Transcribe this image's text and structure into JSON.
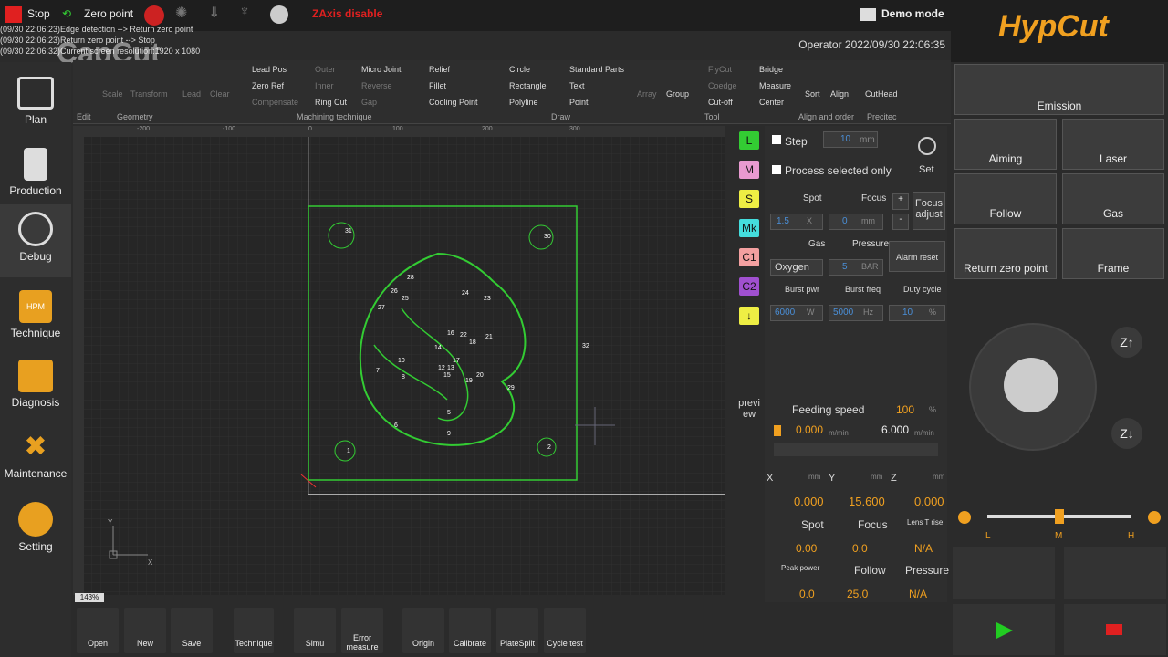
{
  "topbar": {
    "stop": "Stop",
    "zero_point": "Zero point",
    "zaxis": "ZAxis disable",
    "demo": "Demo mode"
  },
  "log": [
    "(09/30 22:06:23)Edge detection --> Return zero point",
    "(09/30 22:06:23)Return zero point --> Stop",
    "(09/30 22:06:32)Current screen resolution:1920 x 1080"
  ],
  "watermark": "CapCut",
  "operator": "Operator   2022/09/30 22:06:35",
  "nav": [
    "Plan",
    "Production",
    "Debug",
    "Technique",
    "Diagnosis",
    "Maintenance",
    "Setting"
  ],
  "ribbon": {
    "edit": "Edit",
    "geometry": "Geometry",
    "scale": "Scale",
    "transform": "Transform",
    "lead": "Lead",
    "clear": "Clear",
    "lead_pos": "Lead Pos",
    "zero_ref": "Zero Ref",
    "compensate": "Compensate",
    "outer": "Outer",
    "inner": "Inner",
    "ring_cut": "Ring Cut",
    "micro_joint": "Micro Joint",
    "reverse": "Reverse",
    "gap": "Gap",
    "relief": "Relief",
    "fillet": "Fillet",
    "cooling_point": "Cooling Point",
    "machining": "Machining technique",
    "circle": "Circle",
    "rectangle": "Rectangle",
    "polyline": "Polyline",
    "standard_parts": "Standard Parts",
    "text": "Text",
    "point": "Point",
    "draw": "Draw",
    "array": "Array",
    "group": "Group",
    "flycut": "FlyCut",
    "coedge": "Coedge",
    "cutoff": "Cut-off",
    "bridge": "Bridge",
    "measure": "Measure",
    "center": "Center",
    "tool": "Tool",
    "sort": "Sort",
    "align": "Align",
    "align_order": "Align and order",
    "cuthead": "CutHead",
    "precitec": "Precitec"
  },
  "ruler": [
    "-200",
    "-100",
    "0",
    "100",
    "200",
    "300"
  ],
  "zoom": "143%",
  "bottom": [
    "Open",
    "New",
    "Save",
    "Technique",
    "Simu",
    "Error measure",
    "Origin",
    "Calibrate",
    "PlateSplit",
    "Cycle test"
  ],
  "layers": [
    "L",
    "M",
    "S",
    "Mk",
    "C1",
    "C2",
    "↓"
  ],
  "preview": "previ ew",
  "params": {
    "step": "Step",
    "step_val": "10",
    "mm": "mm",
    "process_selected": "Process selected only",
    "set": "Set",
    "spot": "Spot",
    "focus": "Focus",
    "spot_val": "1.5",
    "x": "X",
    "focus_val": "0",
    "focus_adjust": "Focus adjust",
    "gas": "Gas",
    "pressure": "Pressure",
    "gas_val": "Oxygen",
    "pressure_val": "5",
    "bar": "BAR",
    "alarm_reset": "Alarm reset",
    "burst_pwr": "Burst pwr",
    "burst_freq": "Burst freq",
    "duty": "Duty cycle",
    "pwr_val": "6000",
    "w": "W",
    "freq_val": "5000",
    "hz": "Hz",
    "duty_val": "10",
    "pct": "%"
  },
  "status": {
    "feeding": "Feeding speed",
    "feed_pct": "100",
    "pct": "%",
    "speed1": "0.000",
    "speed2": "6.000",
    "unit": "m/min",
    "x": "X",
    "y": "Y",
    "z": "Z",
    "mm": "mm",
    "xv": "0.000",
    "yv": "15.600",
    "zv": "0.000",
    "spot": "Spot",
    "focus": "Focus",
    "lens": "Lens T rise",
    "spot_v": "0.00",
    "focus_v": "0.0",
    "lens_v": "N/A",
    "peak": "Peak power",
    "follow": "Follow",
    "pressure": "Pressure",
    "peak_v": "0.0",
    "follow_v": "25.0",
    "pressure_v": "N/A"
  },
  "right": {
    "logo": "HypCut",
    "emission": "Emission",
    "aiming": "Aiming",
    "laser": "Laser",
    "follow": "Follow",
    "gas": "Gas",
    "return": "Return zero point",
    "frame": "Frame",
    "l": "L",
    "m": "M",
    "h": "H"
  },
  "labels": [
    "31",
    "30",
    "28",
    "26",
    "25",
    "27",
    "24",
    "23",
    "16",
    "22",
    "18",
    "21",
    "14",
    "17",
    "13",
    "12",
    "10",
    "7",
    "8",
    "15",
    "19",
    "20",
    "29",
    "32",
    "5",
    "9",
    "6",
    "2",
    "1"
  ]
}
